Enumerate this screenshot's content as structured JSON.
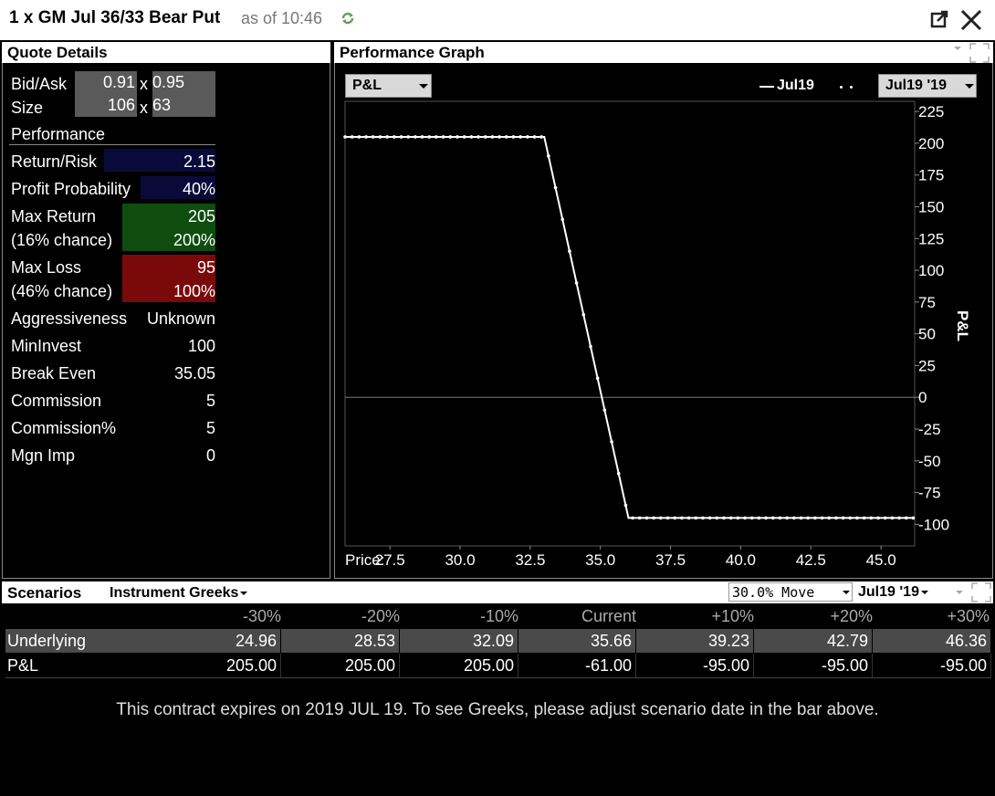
{
  "window": {
    "title": "1 x GM Jul 36/33 Bear Put",
    "asof": "as of 10:46"
  },
  "quote": {
    "header": "Quote Details",
    "bidask_label": "Bid/Ask",
    "bid": "0.91",
    "x": "x",
    "ask": "0.95",
    "size_label": "Size",
    "bid_size": "106",
    "ask_size": "63",
    "performance_label": "Performance",
    "return_risk_label": "Return/Risk",
    "return_risk": "2.15",
    "profit_prob_label": "Profit Probability",
    "profit_prob": "40%",
    "max_return_label": "Max Return",
    "max_return": "205",
    "max_return_chance": "(16% chance)",
    "max_return_pct": "200%",
    "max_loss_label": "Max Loss",
    "max_loss": "95",
    "max_loss_chance": "(46% chance)",
    "max_loss_pct": "100%",
    "aggr_label": "Aggressiveness",
    "aggr": "Unknown",
    "mininvest_label": "MinInvest",
    "mininvest": "100",
    "breakeven_label": "Break Even",
    "breakeven": "35.05",
    "commission_label": "Commission",
    "commission": "5",
    "commission_pct_label": "Commission%",
    "commission_pct": "5",
    "mgn_label": "Mgn Imp",
    "mgn": "0",
    "colors": {
      "return_risk_bg": "#0a0a3a",
      "max_return_bg": "#0f4d0f",
      "max_loss_bg": "#7a0a0a"
    }
  },
  "performance": {
    "header": "Performance Graph",
    "metric_select": "P&L",
    "legend_line": "Jul19",
    "date_select": "Jul19 '19"
  },
  "chart_data": {
    "type": "line",
    "xlabel": "Price:",
    "ylabel": "P&L",
    "xlim": [
      25.9,
      46.2
    ],
    "ylim": [
      -117,
      233
    ],
    "xticks": [
      27.5,
      30.0,
      32.5,
      35.0,
      37.5,
      40.0,
      42.5,
      45.0
    ],
    "xtick_labels": [
      "27.5",
      "30.0",
      "32.5",
      "35.0",
      "37.5",
      "40.0",
      "42.5",
      "45.0"
    ],
    "yticks": [
      225,
      200,
      175,
      150,
      125,
      100,
      75,
      50,
      25,
      0,
      -25,
      -50,
      -75,
      -100
    ],
    "series": [
      {
        "name": "Jul19",
        "x": [
          25.9,
          33.0,
          36.0,
          46.2
        ],
        "y": [
          205,
          205,
          -95,
          -95
        ]
      }
    ],
    "zero_line": true,
    "grid": false
  },
  "scenarios": {
    "title": "Scenarios",
    "greeks_select": "Instrument Greeks",
    "move_select": "30.0% Move",
    "date_select": "Jul19 '19",
    "columns": [
      "-30%",
      "-20%",
      "-10%",
      "Current",
      "+10%",
      "+20%",
      "+30%"
    ],
    "rows": [
      {
        "label": "Underlying",
        "values": [
          "24.96",
          "28.53",
          "32.09",
          "35.66",
          "39.23",
          "42.79",
          "46.36"
        ]
      },
      {
        "label": "P&L",
        "values": [
          "205.00",
          "205.00",
          "205.00",
          "-61.00",
          "-95.00",
          "-95.00",
          "-95.00"
        ]
      }
    ],
    "message": "This contract expires on 2019 JUL 19. To see Greeks, please adjust scenario date in the bar above."
  }
}
